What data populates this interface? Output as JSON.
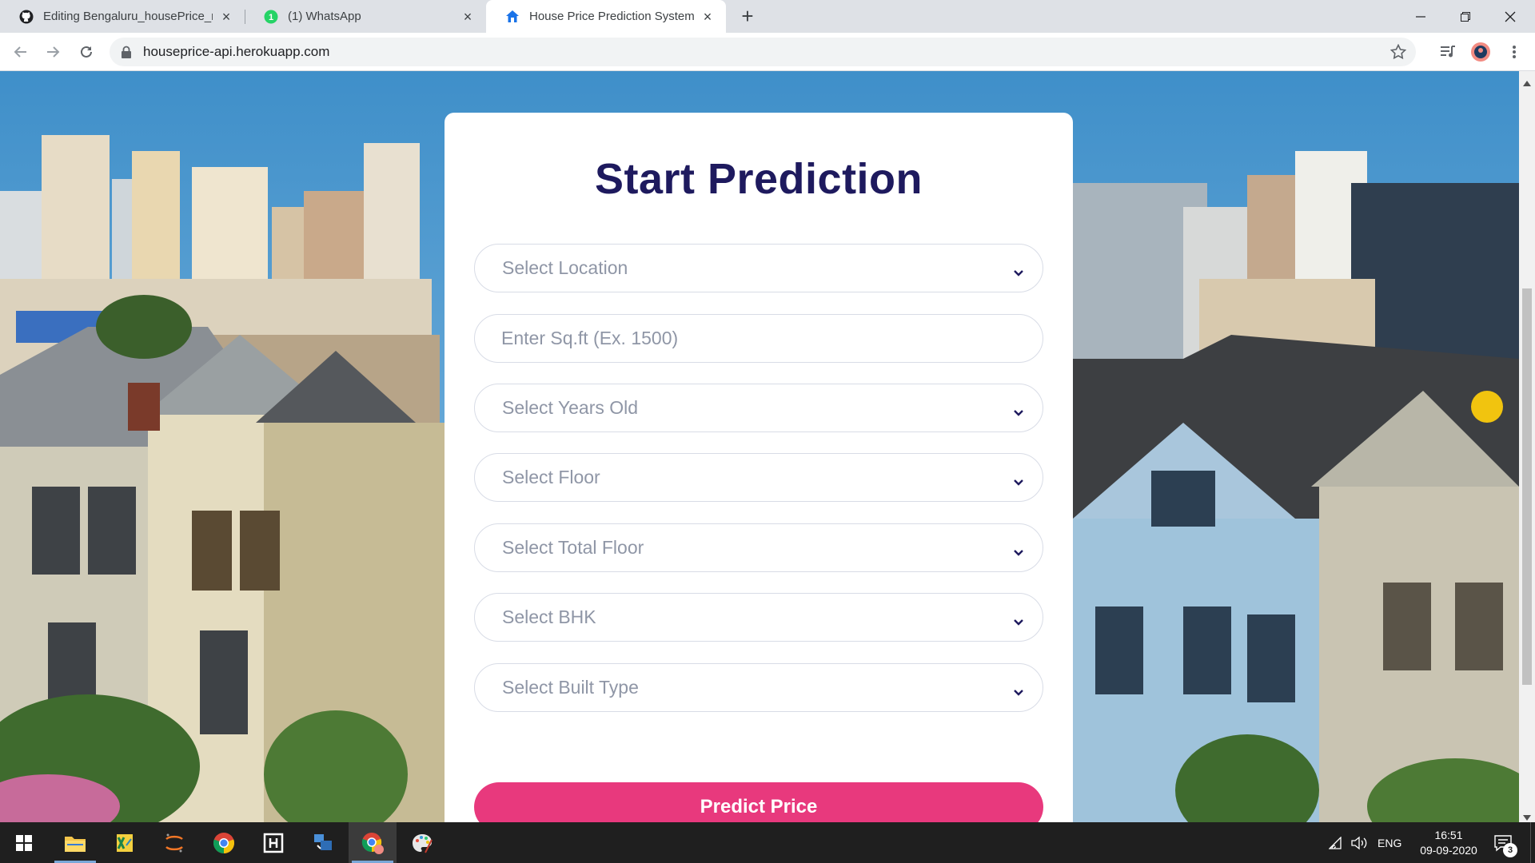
{
  "browser": {
    "tabs": [
      {
        "title": "Editing Bengaluru_housePrice_m",
        "favicon": "github-icon"
      },
      {
        "title": "(1) WhatsApp",
        "favicon": "whatsapp-icon"
      },
      {
        "title": "House Price Prediction System",
        "favicon": "house-icon"
      }
    ],
    "url": "houseprice-api.herokuapp.com"
  },
  "form": {
    "title": "Start Prediction",
    "location_placeholder": "Select Location",
    "sqft_placeholder": "Enter Sq.ft (Ex. 1500)",
    "years_placeholder": "Select Years Old",
    "floor_placeholder": "Select Floor",
    "total_floor_placeholder": "Select Total Floor",
    "bhk_placeholder": "Select BHK",
    "built_type_placeholder": "Select Built Type",
    "submit_label": "Predict Price"
  },
  "taskbar": {
    "language": "ENG",
    "time": "16:51",
    "date": "09-09-2020",
    "notification_count": "3"
  },
  "colors": {
    "title_navy": "#1e1a5e",
    "accent_pink": "#e8397d",
    "field_border": "#d8dce6",
    "placeholder_gray": "#8f96a6"
  }
}
